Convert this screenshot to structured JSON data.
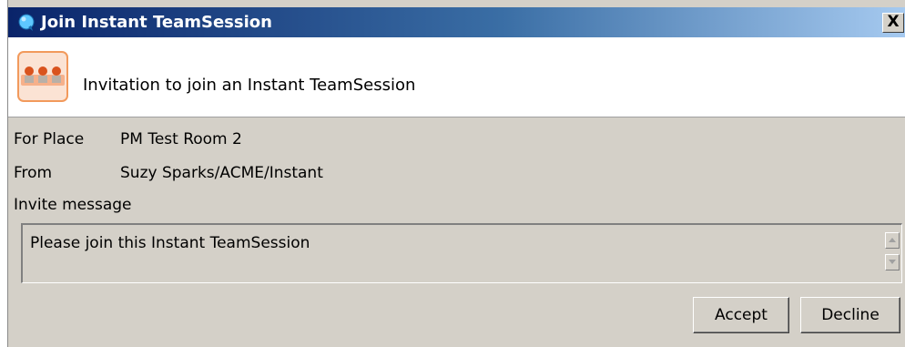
{
  "window": {
    "title": "Join Instant TeamSession",
    "close_label": "X"
  },
  "header": {
    "text": "Invitation to join an Instant TeamSession"
  },
  "fields": {
    "place_label": "For Place",
    "place_value": "PM Test Room 2",
    "from_label": "From",
    "from_value": "Suzy Sparks/ACME/Instant",
    "message_label": "Invite message"
  },
  "message": {
    "value": "Please join this Instant TeamSession"
  },
  "buttons": {
    "accept_label": "Accept",
    "decline_label": "Decline"
  },
  "icons": {
    "title_icon": "sametime-bubble-icon",
    "header_icon": "team-session-icon"
  },
  "colors": {
    "titlebar_start": "#0a246a",
    "titlebar_end": "#a6caf0",
    "dialog_background": "#d4d0c8",
    "session_icon_border": "#f29a5c"
  }
}
